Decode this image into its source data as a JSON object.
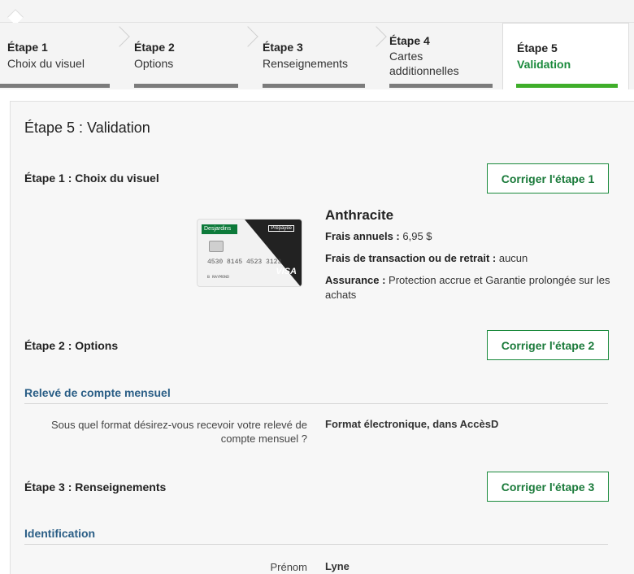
{
  "steps": [
    {
      "label": "Étape 1",
      "title": "Choix du visuel"
    },
    {
      "label": "Étape 2",
      "title": "Options"
    },
    {
      "label": "Étape 3",
      "title": "Renseignements"
    },
    {
      "label": "Étape 4",
      "title": "Cartes additionnelles"
    },
    {
      "label": "Étape 5",
      "title": "Validation"
    }
  ],
  "page_title": "Étape 5 : Validation",
  "section1": {
    "title": "Étape 1 : Choix du visuel",
    "button": "Corriger l'étape 1",
    "card": {
      "brand": "Desjardins",
      "badge": "Prépayée",
      "number": "4530 8145 4523 3123",
      "holder": "B  RAYMOND",
      "network": "VISA"
    },
    "product_name": "Anthracite",
    "fees_label": "Frais annuels :",
    "fees_value": "6,95 $",
    "transaction_label": "Frais de transaction ou de retrait :",
    "transaction_value": "aucun",
    "insurance_label": "Assurance :",
    "insurance_value": "Protection accrue et Garantie prolongée sur les achats"
  },
  "section2": {
    "title": "Étape 2 : Options",
    "button": "Corriger l'étape 2",
    "subsection": "Relevé de compte mensuel",
    "question": "Sous quel format désirez-vous recevoir votre relevé de compte mensuel ?",
    "answer": "Format électronique, dans AccèsD"
  },
  "section3": {
    "title": "Étape 3 : Renseignements",
    "button": "Corriger l'étape 3",
    "subsection": "Identification",
    "field_label": "Prénom",
    "field_value": "Lyne"
  }
}
